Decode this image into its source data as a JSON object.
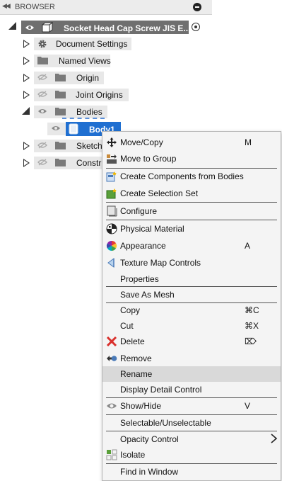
{
  "browser": {
    "title": "BROWSER",
    "collapse_icon": "double-chevron-left-icon",
    "header_button_icon": "minus-circle-icon"
  },
  "tree": {
    "root": {
      "label": "Socket Head Cap Screw JIS E...",
      "active_icon": "radio-dot-icon"
    },
    "items": [
      {
        "label": "Document Settings",
        "icon": "gear-icon"
      },
      {
        "label": "Named Views",
        "icon": "folder-icon"
      },
      {
        "label": "Origin",
        "icon": "folder-icon",
        "visibility": "hidden"
      },
      {
        "label": "Joint Origins",
        "icon": "folder-icon",
        "visibility": "hidden"
      },
      {
        "label": "Bodies",
        "icon": "folder-icon",
        "visibility": "visible",
        "expanded": true
      },
      {
        "label": "Body1",
        "icon": "body-icon",
        "selected": true
      },
      {
        "label": "Sketch",
        "icon": "folder-icon",
        "visibility": "hidden"
      },
      {
        "label": "Constr",
        "icon": "folder-icon",
        "visibility": "hidden"
      }
    ]
  },
  "context_menu": {
    "items": [
      {
        "label": "Move/Copy",
        "shortcut": "M",
        "icon": "move-arrows-icon"
      },
      {
        "label": "Move to Group",
        "shortcut": "",
        "icon": "move-to-group-icon"
      },
      {
        "label": "Create Components from Bodies",
        "shortcut": "",
        "icon": "create-components-icon"
      },
      {
        "label": "Create Selection Set",
        "shortcut": "",
        "icon": "selection-set-icon"
      },
      {
        "label": "Configure",
        "shortcut": "",
        "icon": "configure-icon"
      },
      {
        "label": "Physical Material",
        "shortcut": "",
        "icon": "physical-material-icon"
      },
      {
        "label": "Appearance",
        "shortcut": "A",
        "icon": "appearance-color-wheel-icon"
      },
      {
        "label": "Texture Map Controls",
        "shortcut": "",
        "icon": "texture-map-icon"
      },
      {
        "label": "Properties",
        "shortcut": "",
        "icon": ""
      },
      {
        "label": "Save As Mesh",
        "shortcut": "",
        "icon": ""
      },
      {
        "label": "Copy",
        "shortcut": "⌘C",
        "icon": ""
      },
      {
        "label": "Cut",
        "shortcut": "⌘X",
        "icon": ""
      },
      {
        "label": "Delete",
        "shortcut": "⌦",
        "icon": "delete-x-icon"
      },
      {
        "label": "Remove",
        "shortcut": "",
        "icon": "remove-icon"
      },
      {
        "label": "Rename",
        "shortcut": "",
        "icon": "",
        "highlighted": true
      },
      {
        "label": "Display Detail Control",
        "shortcut": "",
        "icon": ""
      },
      {
        "label": "Show/Hide",
        "shortcut": "V",
        "icon": "eye-icon"
      },
      {
        "label": "Selectable/Unselectable",
        "shortcut": "",
        "icon": ""
      },
      {
        "label": "Opacity Control",
        "shortcut": "",
        "icon": "",
        "submenu": true
      },
      {
        "label": "Isolate",
        "shortcut": "",
        "icon": "isolate-icon"
      },
      {
        "label": "Find in Window",
        "shortcut": "",
        "icon": ""
      }
    ]
  },
  "colors": {
    "selection_blue": "#1f6fd1",
    "root_gray": "#6f6f6f",
    "menu_bg": "#f4f4f4",
    "highlight": "#d9d9d9",
    "delete_red": "#d9302c"
  }
}
